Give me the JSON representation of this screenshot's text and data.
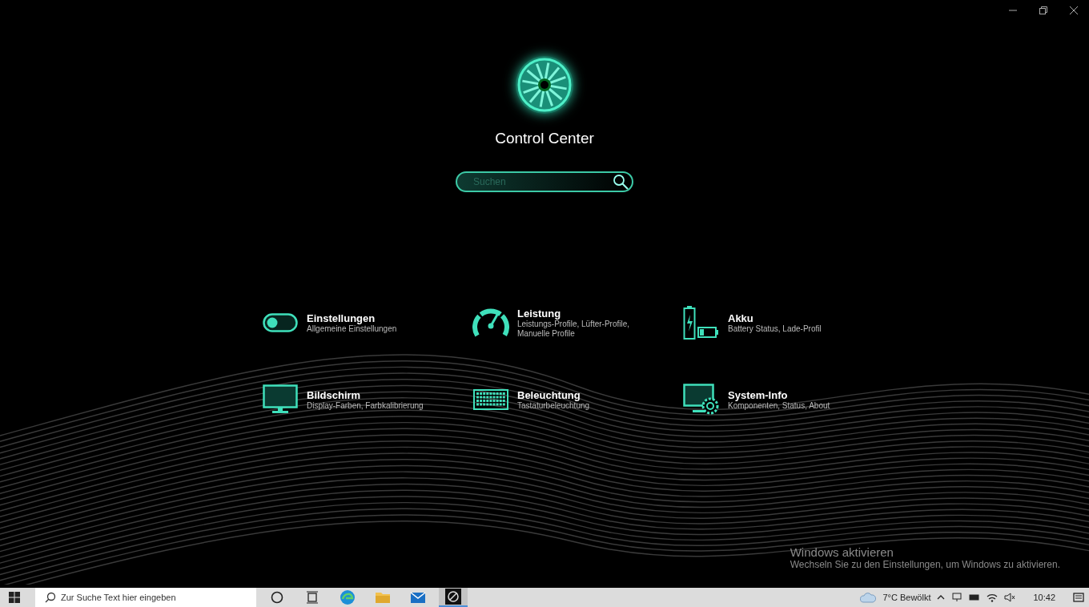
{
  "window": {
    "title": "Control Center"
  },
  "search": {
    "placeholder": "Suchen"
  },
  "tiles": [
    {
      "kind": "toggle",
      "title": "Einstellungen",
      "subtitle": "Allgemeine Einstellungen"
    },
    {
      "kind": "gauge",
      "title": "Leistung",
      "subtitle": "Leistungs-Profile, Lüfter-Profile, Manuelle Profile"
    },
    {
      "kind": "battery",
      "title": "Akku",
      "subtitle": "Battery Status, Lade-Profil"
    },
    {
      "kind": "monitor",
      "title": "Bildschirm",
      "subtitle": "Display-Farben, Farbkalibrierung"
    },
    {
      "kind": "keyboard",
      "title": "Beleuchtung",
      "subtitle": "Tastaturbeleuchtung"
    },
    {
      "kind": "sysinfo",
      "title": "System-Info",
      "subtitle": "Komponenten, Status, About"
    }
  ],
  "activation": {
    "title": "Windows aktivieren",
    "text": "Wechseln Sie zu den Einstellungen, um Windows zu aktivieren."
  },
  "taskbar": {
    "search_placeholder": "Zur Suche Text hier eingeben",
    "apps": [
      {
        "kind": "edge",
        "selected": false
      },
      {
        "kind": "folder",
        "selected": false
      },
      {
        "kind": "mail",
        "selected": false
      },
      {
        "kind": "control",
        "selected": true
      }
    ],
    "weather": "7°C Bewölkt",
    "time": "10:42"
  }
}
